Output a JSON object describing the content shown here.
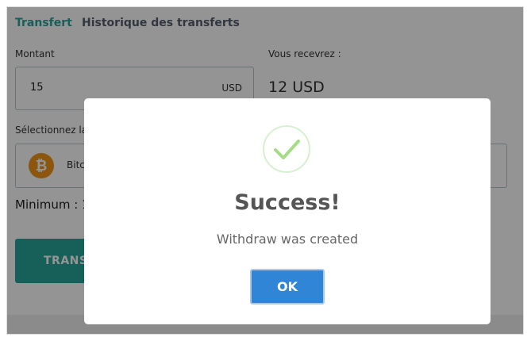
{
  "tabs": {
    "active": "Transfert",
    "history": "Historique des transferts"
  },
  "form": {
    "amount_label": "Montant",
    "amount_value": "15",
    "amount_currency": "USD",
    "receive_label": "Vous recevrez :",
    "receive_value": "12 USD",
    "method_label": "Sélectionnez la",
    "method_icon": "bitcoin-icon",
    "method_coin_glyph": "₿",
    "method_name": "Bitc",
    "minimum_text": "Minimum : 1",
    "transfer_button": "TRANS"
  },
  "modal": {
    "icon": "check-icon",
    "title": "Success!",
    "message": "Withdraw was created",
    "ok_label": "OK"
  },
  "colors": {
    "accent": "#26a69a",
    "ok_button": "#3085d6",
    "success_check": "#a5dc86",
    "bitcoin": "#f2941b"
  }
}
